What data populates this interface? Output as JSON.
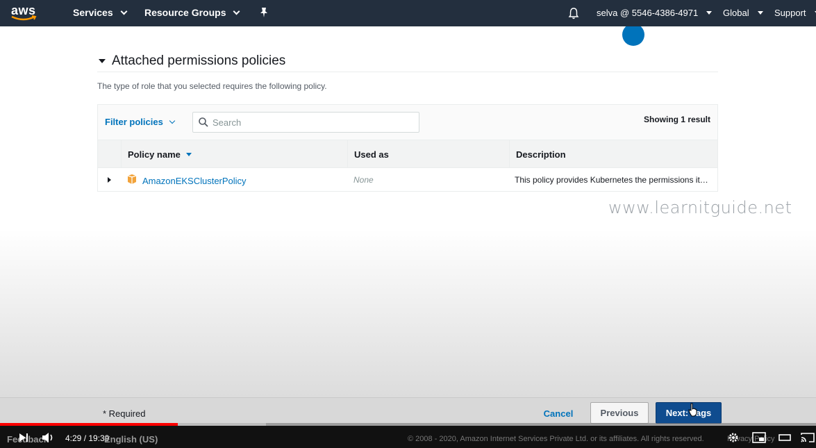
{
  "nav": {
    "logo_text": "aws",
    "services": "Services",
    "resource_groups": "Resource Groups",
    "account": "selva @ 5546-4386-4971",
    "region": "Global",
    "support": "Support"
  },
  "section": {
    "title": "Attached permissions policies",
    "description": "The type of role that you selected requires the following policy."
  },
  "table": {
    "filter_label": "Filter policies",
    "search_placeholder": "Search",
    "result_count": "Showing 1 result",
    "columns": {
      "policy_name": "Policy name",
      "used_as": "Used as",
      "description": "Description"
    },
    "rows": [
      {
        "policy_name": "AmazonEKSClusterPolicy",
        "used_as": "None",
        "description": "This policy provides Kubernetes the permissions it requires to manage resources on your behalf."
      }
    ]
  },
  "watermark": "www.learnitguide.net",
  "footer": {
    "required": "* Required",
    "cancel": "Cancel",
    "previous": "Previous",
    "next": "Next: Tags"
  },
  "player": {
    "feedback": "Feedback",
    "time": "4:29 / 19:39",
    "language": "English (US)",
    "copyright": "© 2008 - 2020, Amazon Internet Services Private Ltd. or its affiliates. All rights reserved.",
    "privacy": "Privacy Policy",
    "progress_played_fraction": 0.218,
    "progress_buffered_fraction": 0.326
  },
  "colors": {
    "nav_bg": "#232f3e",
    "link": "#0073bb",
    "primary_button": "#0f4c8f",
    "progress": "#ff0000"
  }
}
